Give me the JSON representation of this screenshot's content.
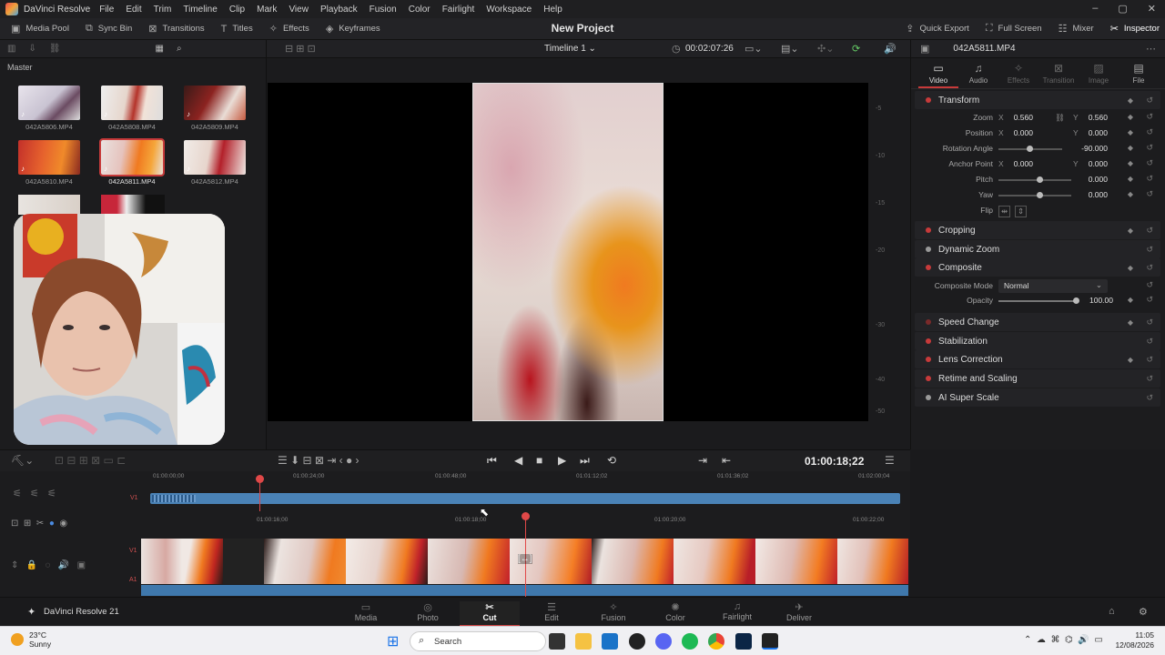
{
  "titlebar": {
    "app_name": "DaVinci Resolve",
    "menu": [
      "File",
      "Edit",
      "Trim",
      "Timeline",
      "Clip",
      "Mark",
      "View",
      "Playback",
      "Fusion",
      "Color",
      "Fairlight",
      "Workspace",
      "Help"
    ]
  },
  "toolbar": {
    "left": [
      {
        "icon": "media-pool-icon",
        "label": "Media Pool"
      },
      {
        "icon": "sync-bin-icon",
        "label": "Sync Bin"
      },
      {
        "icon": "transitions-icon",
        "label": "Transitions"
      },
      {
        "icon": "titles-icon",
        "label": "Titles"
      },
      {
        "icon": "effects-icon",
        "label": "Effects"
      },
      {
        "icon": "keyframes-icon",
        "label": "Keyframes"
      }
    ],
    "project_title": "New Project",
    "right": [
      {
        "icon": "quick-export-icon",
        "label": "Quick Export"
      },
      {
        "icon": "full-screen-icon",
        "label": "Full Screen"
      },
      {
        "icon": "mixer-icon",
        "label": "Mixer"
      },
      {
        "icon": "inspector-icon",
        "label": "Inspector"
      }
    ]
  },
  "media_pool": {
    "bin": "Master",
    "clips": [
      {
        "name": "042A5806.MP4",
        "selected": false
      },
      {
        "name": "042A5808.MP4",
        "selected": false
      },
      {
        "name": "042A5809.MP4",
        "selected": false
      },
      {
        "name": "042A5810.MP4",
        "selected": false
      },
      {
        "name": "042A5811.MP4",
        "selected": true
      },
      {
        "name": "042A5812.MP4",
        "selected": false
      }
    ]
  },
  "viewer": {
    "timeline_name": "Timeline 1",
    "duration": "00:02:07:26",
    "scale_marks": [
      "-5",
      "-10",
      "-15",
      "-20",
      "-30",
      "-40",
      "-50"
    ]
  },
  "inspector": {
    "file_name": "042A5811.MP4",
    "tabs": [
      {
        "label": "Video",
        "active": true
      },
      {
        "label": "Audio",
        "active": false
      },
      {
        "label": "Effects",
        "active": false
      },
      {
        "label": "Transition",
        "active": false
      },
      {
        "label": "Image",
        "active": false
      },
      {
        "label": "File",
        "active": false
      }
    ],
    "transform": {
      "title": "Transform",
      "zoom": {
        "label": "Zoom",
        "x": "0.560",
        "y": "0.560"
      },
      "position": {
        "label": "Position",
        "x": "0.000",
        "y": "0.000"
      },
      "rotation": {
        "label": "Rotation Angle",
        "value": "-90.000"
      },
      "anchor": {
        "label": "Anchor Point",
        "x": "0.000",
        "y": "0.000"
      },
      "pitch": {
        "label": "Pitch",
        "value": "0.000"
      },
      "yaw": {
        "label": "Yaw",
        "value": "0.000"
      },
      "flip": {
        "label": "Flip"
      }
    },
    "sections": {
      "cropping": "Cropping",
      "dynamic_zoom": "Dynamic Zoom",
      "composite": "Composite",
      "speed": "Speed Change",
      "stabilization": "Stabilization",
      "lens": "Lens Correction",
      "retime": "Retime and Scaling",
      "superscale": "AI Super Scale"
    },
    "composite": {
      "mode_label": "Composite Mode",
      "mode_value": "Normal",
      "opacity_label": "Opacity",
      "opacity_value": "100.00"
    }
  },
  "transport": {
    "timecode": "01:00:18;22"
  },
  "timeline": {
    "upper_ruler": [
      "01:00:00;00",
      "01:00:24;00",
      "01:00:48;00",
      "01:01:12;02",
      "01:01:36;02",
      "01:02:00;04"
    ],
    "lower_ruler": [
      "01:00:16;00",
      "01:00:18;00",
      "01:00:20;00",
      "01:00:22;00"
    ],
    "track_v1": "V1",
    "track_a1": "A1"
  },
  "pages": [
    {
      "label": "Media",
      "icon": "media-page-icon",
      "active": false
    },
    {
      "label": "Photo",
      "icon": "photo-page-icon",
      "active": false
    },
    {
      "label": "Cut",
      "icon": "cut-page-icon",
      "active": true
    },
    {
      "label": "Edit",
      "icon": "edit-page-icon",
      "active": false
    },
    {
      "label": "Fusion",
      "icon": "fusion-page-icon",
      "active": false
    },
    {
      "label": "Color",
      "icon": "color-page-icon",
      "active": false
    },
    {
      "label": "Fairlight",
      "icon": "fairlight-page-icon",
      "active": false
    },
    {
      "label": "Deliver",
      "icon": "deliver-page-icon",
      "active": false
    }
  ],
  "brand": "DaVinci Resolve 21",
  "taskbar": {
    "weather_temp": "23°C",
    "weather_desc": "Sunny",
    "search_placeholder": "Search",
    "time": "11:05",
    "date": "12/08/2026"
  },
  "colors": {
    "accent_red": "#c73a3a",
    "clip_blue": "#4a82b6"
  }
}
